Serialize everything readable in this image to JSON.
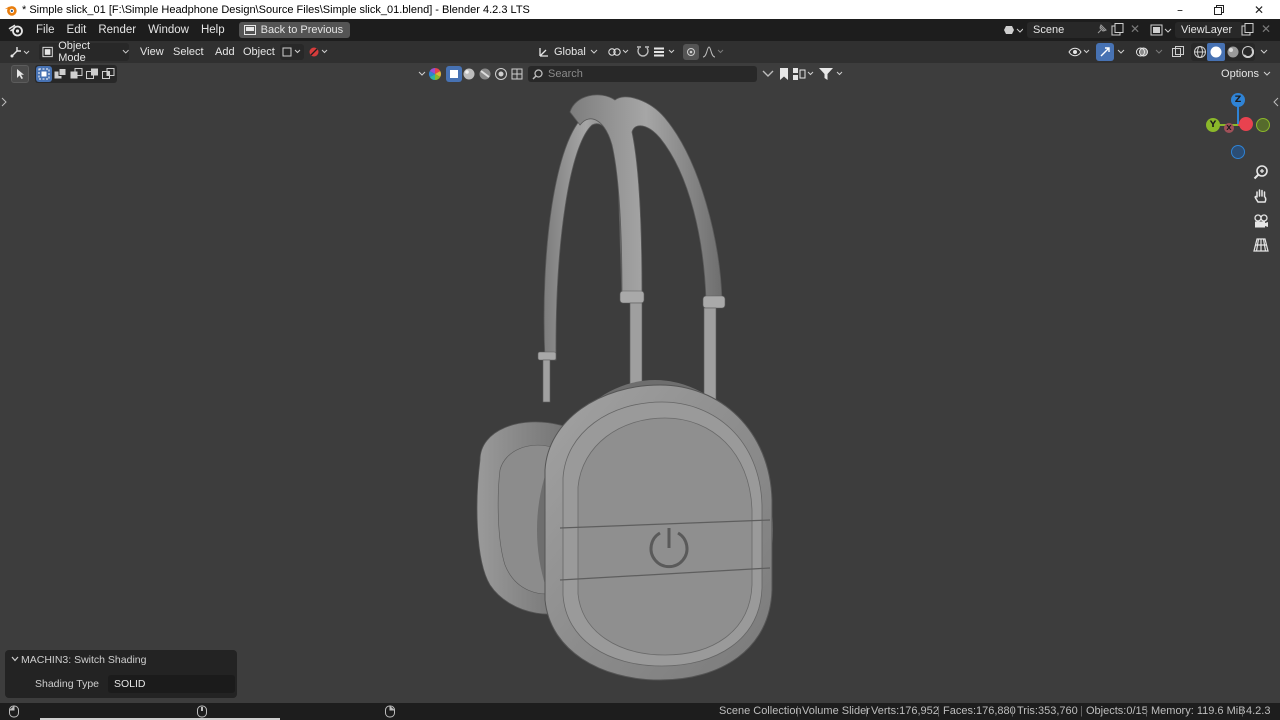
{
  "window": {
    "title": "* Simple slick_01 [F:\\Simple Headphone Design\\Source Files\\Simple slick_01.blend] - Blender 4.2.3 LTS"
  },
  "topbar": {
    "menus": [
      "File",
      "Edit",
      "Render",
      "Window",
      "Help"
    ],
    "back_button": "Back to Previous",
    "scene_name": "Scene",
    "view_layer": "ViewLayer"
  },
  "viewport_header": {
    "mode": "Object Mode",
    "menus": [
      "View",
      "Select",
      "Add",
      "Object"
    ],
    "transform_orientation": "Global",
    "search_placeholder": "Search",
    "options_label": "Options"
  },
  "gizmo": {
    "axes": [
      "Z",
      "Y",
      "X"
    ],
    "colors": {
      "x": "#e8424f",
      "y": "#8bb82a",
      "z": "#2f83d5"
    }
  },
  "operator_panel": {
    "title": "MACHIN3: Switch Shading",
    "label": "Shading Type",
    "value": "SOLID"
  },
  "statusbar": {
    "collection": "Scene Collection",
    "active_object": "Volume Slider",
    "verts": "Verts:176,952",
    "faces": "Faces:176,880",
    "tris": "Tris:353,760",
    "objects": "Objects:0/15",
    "memory": "Memory: 119.6 MiB",
    "version": "4.2.3"
  },
  "colors": {
    "accent": "#4772b3",
    "viewport_bg": "#3d3d3d",
    "header_bg": "#303030",
    "topbar_bg": "#1d1d1d"
  }
}
